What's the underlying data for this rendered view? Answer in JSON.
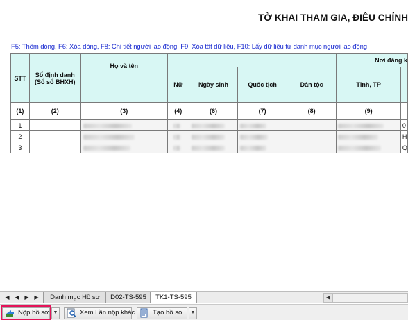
{
  "title": "TỜ KHAI THAM GIA, ĐIỀU CHỈNH",
  "hint": "F5: Thêm dòng, F6: Xóa dòng, F8: Chi tiết người lao động, F9: Xóa tất dữ liệu, F10: Lấy dữ liệu từ danh mục người lao động",
  "table": {
    "headers": {
      "stt": "STT",
      "so_dinh_danh_1": "Số định danh",
      "so_dinh_danh_2": "(Sổ sổ BHXH)",
      "ho_ten": "Họ và tên",
      "nu": "Nữ",
      "ngay_sinh": "Ngày sinh",
      "quoc_tich": "Quốc tịch",
      "dan_toc": "Dân tộc",
      "noi_dang_ky": "Nơi đăng k",
      "tinh_tp": "Tỉnh, TP"
    },
    "col_numbers": [
      "(1)",
      "(2)",
      "(3)",
      "(4)",
      "(6)",
      "(7)",
      "(8)",
      "(9)"
    ],
    "rows": [
      {
        "stt": "1",
        "edge": "0"
      },
      {
        "stt": "2",
        "edge": "H"
      },
      {
        "stt": "3",
        "edge": "Q"
      }
    ]
  },
  "sheet_tabs": {
    "tab1": "Danh mục Hồ sơ",
    "tab2": "D02-TS-595",
    "tab3": "TK1-TS-595",
    "active": "TK1-TS-595"
  },
  "actions": {
    "nop_ho_so": "Nộp hồ sơ",
    "xem_lan_nop_khac": "Xem Lần nộp khác",
    "tao_ho_so": "Tạo hồ sơ"
  },
  "colors": {
    "header_bg": "#d8f7f4",
    "hint_text": "#1a2bd0",
    "highlight": "#e4145a"
  }
}
